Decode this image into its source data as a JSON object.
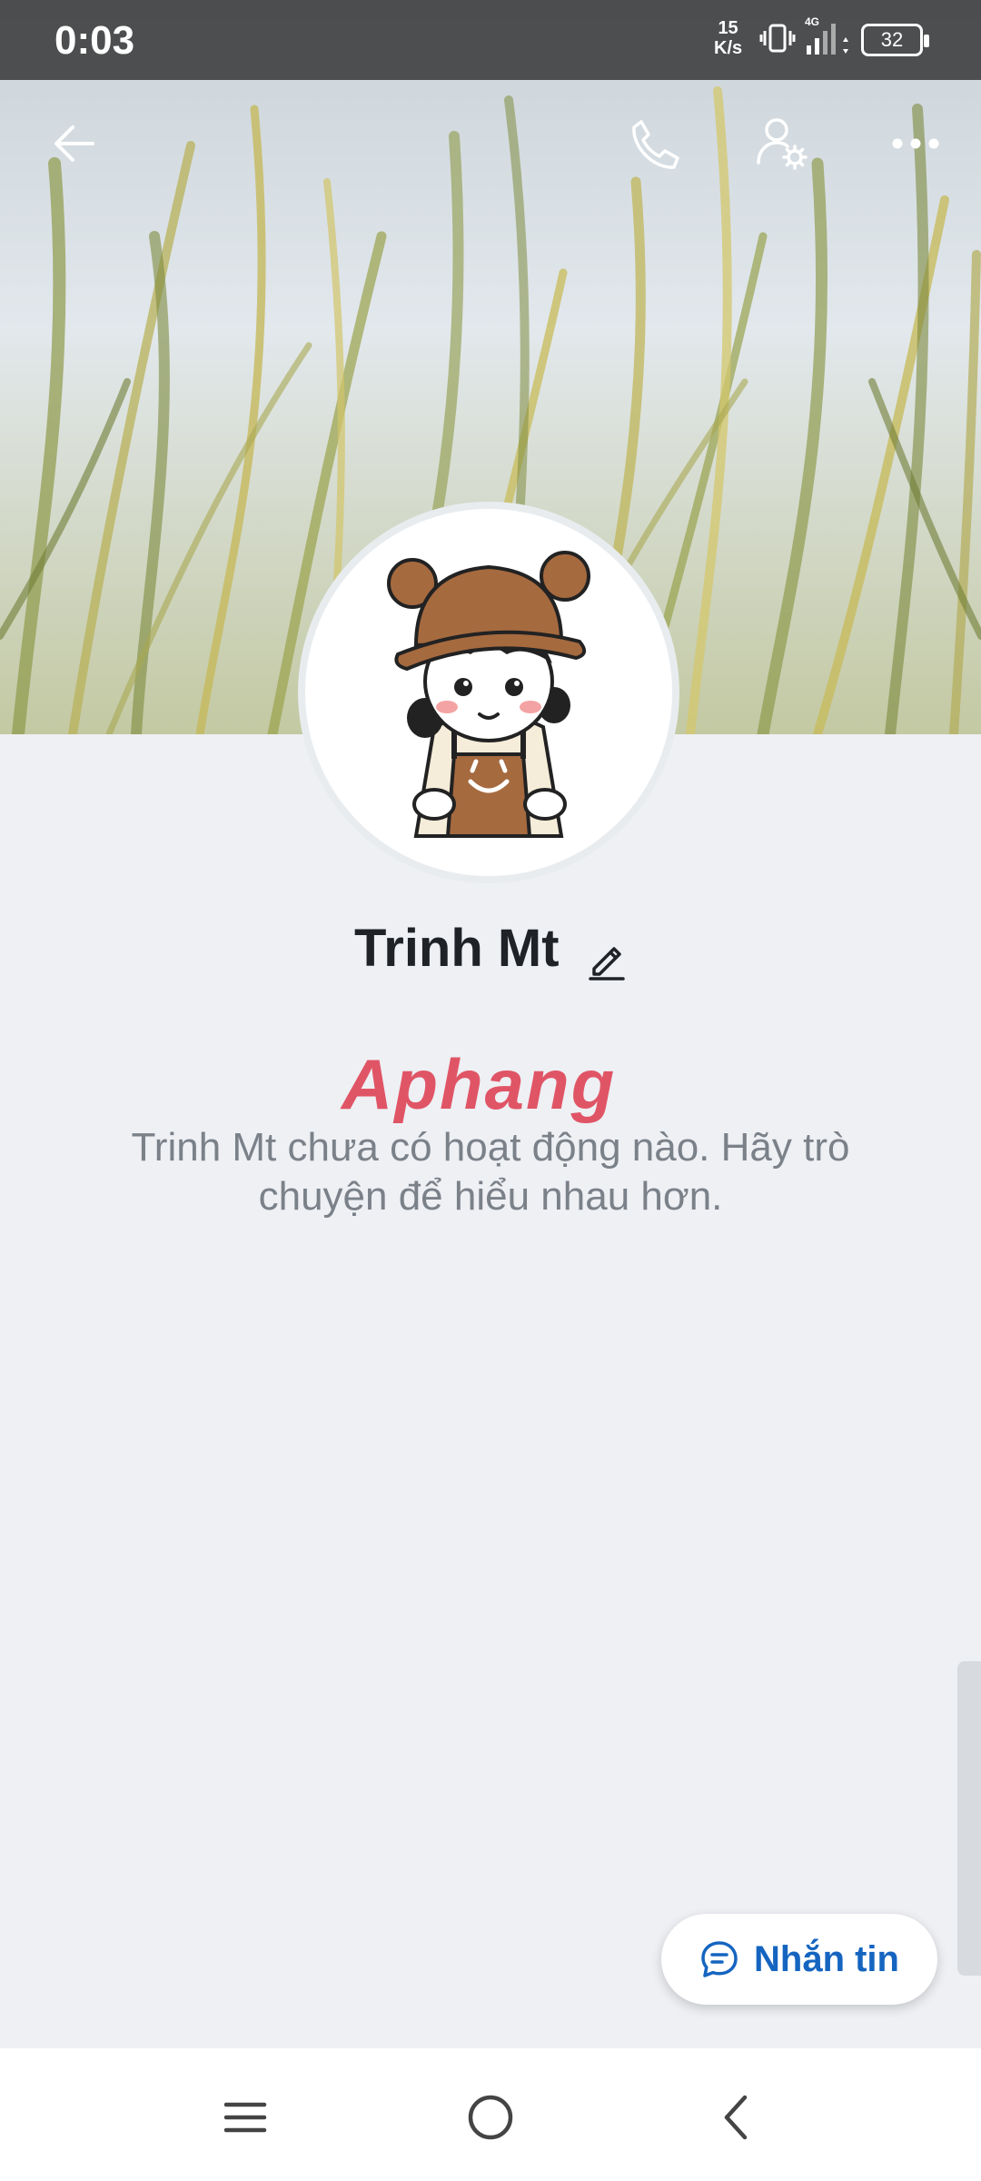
{
  "status_bar": {
    "time": "0:03",
    "net_speed_value": "15",
    "net_speed_unit": "K/s",
    "network": "4G",
    "battery": "32"
  },
  "top_bar": {
    "icons": [
      "back-arrow-icon",
      "phone-icon",
      "user-settings-icon",
      "more-icon"
    ]
  },
  "profile": {
    "name": "Trinh Mt",
    "empty_message": "Trinh Mt chưa có hoạt động nào. Hãy trò chuyện để hiểu nhau hơn.",
    "watermark_part1": "Aphang",
    "watermark_part2": ""
  },
  "actions": {
    "message_label": "Nhắn tin"
  },
  "nav_bar": {
    "icons": [
      "menu-icon",
      "home-icon",
      "back-icon"
    ]
  },
  "colors": {
    "accent": "#1565c0",
    "background": "#eef0f4"
  }
}
